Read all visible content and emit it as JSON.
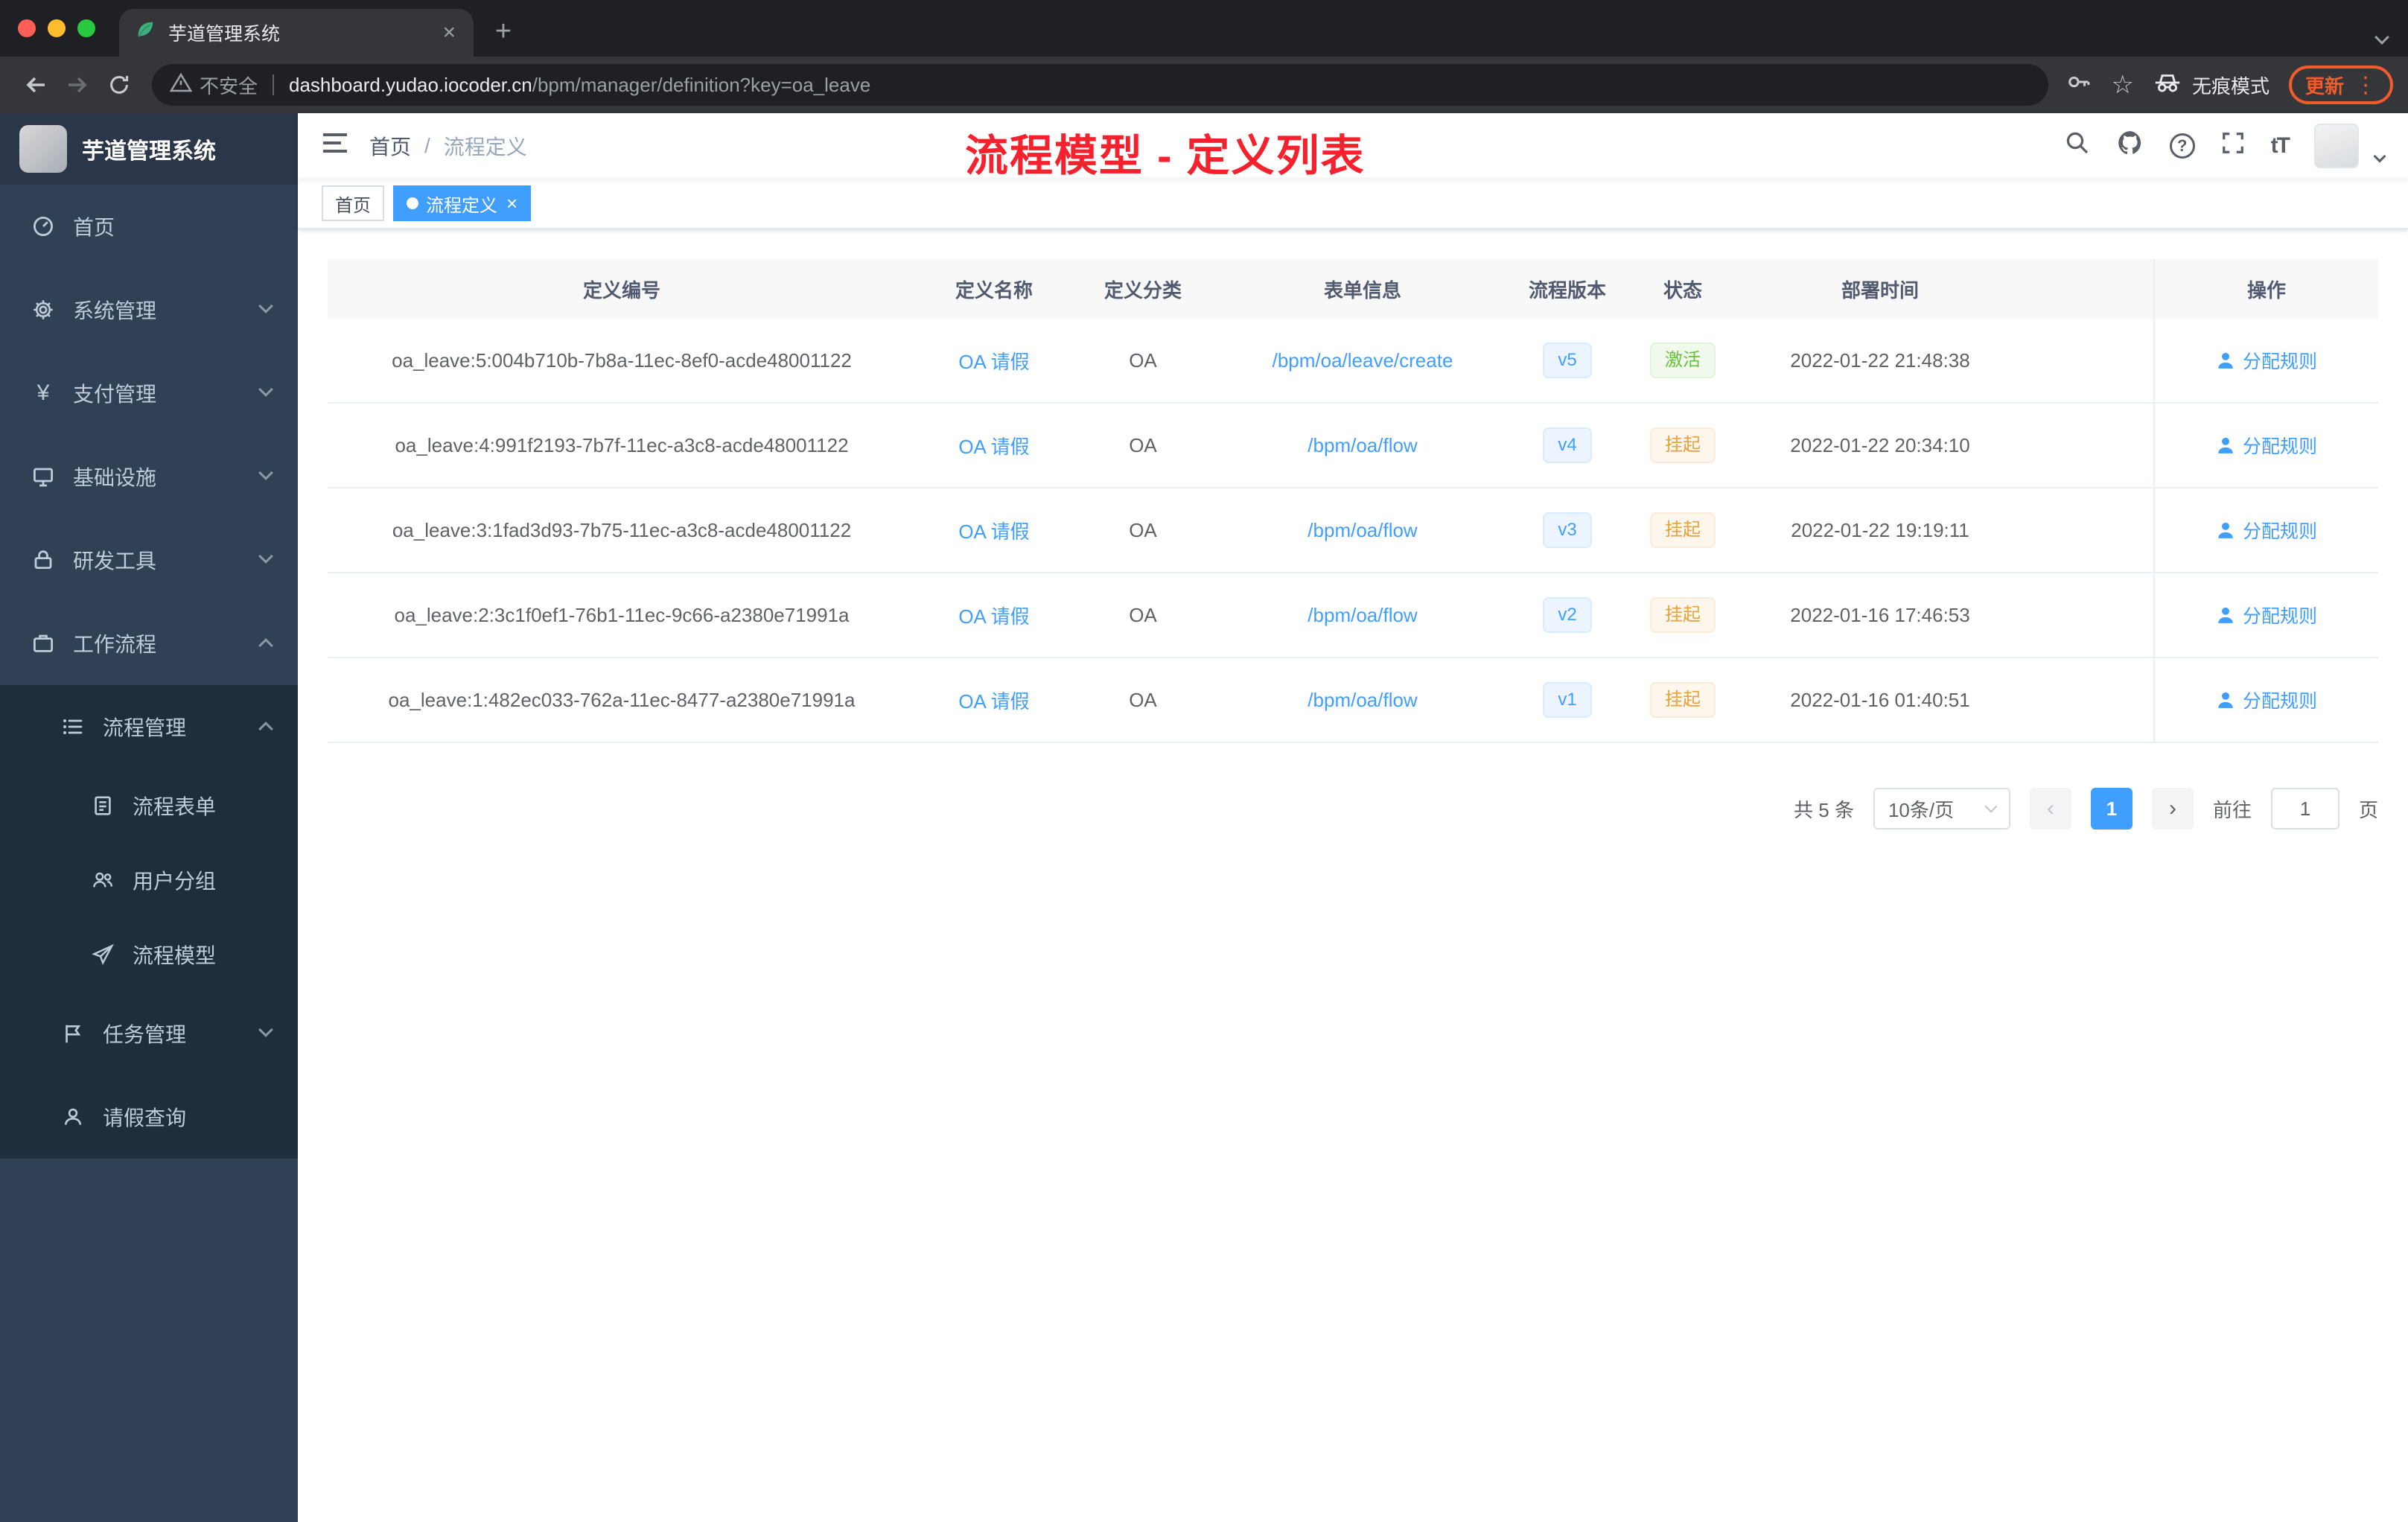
{
  "colors": {
    "accent": "#409eff",
    "success": "#67c23a",
    "warning": "#e6a23c",
    "danger": "#f5222d",
    "update": "#f25b2a"
  },
  "icons": {
    "close_glyph": "×",
    "plus_glyph": "+",
    "star_glyph": "☆",
    "kebab_glyph": "⋮",
    "question_glyph": "?",
    "yen_glyph": "¥",
    "font_size_glyph": "tT",
    "prev_glyph": "‹",
    "next_glyph": "›"
  },
  "browser": {
    "tab_title": "芋道管理系统",
    "security_text": "不安全",
    "url_domain": "dashboard.yudao.iocoder.cn",
    "url_path": "/bpm/manager/definition?key=oa_leave",
    "incognito_label": "无痕模式",
    "update_label": "更新"
  },
  "sidebar": {
    "logo_title": "芋道管理系统",
    "items": [
      {
        "label": "首页"
      },
      {
        "label": "系统管理"
      },
      {
        "label": "支付管理"
      },
      {
        "label": "基础设施"
      },
      {
        "label": "研发工具"
      },
      {
        "label": "工作流程"
      },
      {
        "label": "流程管理"
      },
      {
        "label": "流程表单"
      },
      {
        "label": "用户分组"
      },
      {
        "label": "流程模型"
      },
      {
        "label": "任务管理"
      },
      {
        "label": "请假查询"
      }
    ]
  },
  "header": {
    "breadcrumb_home": "首页",
    "breadcrumb_sep": "/",
    "breadcrumb_current": "流程定义",
    "annotation": "流程模型 - 定义列表"
  },
  "tags": {
    "home": "首页",
    "active": "流程定义"
  },
  "table": {
    "columns": [
      "定义编号",
      "定义名称",
      "定义分类",
      "表单信息",
      "流程版本",
      "状态",
      "部署时间",
      "操作"
    ],
    "rows": [
      {
        "id": "oa_leave:5:004b710b-7b8a-11ec-8ef0-acde48001122",
        "name": "OA 请假",
        "category": "OA",
        "form": "/bpm/oa/leave/create",
        "version": "v5",
        "status": "激活",
        "status_type": "success",
        "deployed_at": "2022-01-22 21:48:38",
        "action": "分配规则"
      },
      {
        "id": "oa_leave:4:991f2193-7b7f-11ec-a3c8-acde48001122",
        "name": "OA 请假",
        "category": "OA",
        "form": "/bpm/oa/flow",
        "version": "v4",
        "status": "挂起",
        "status_type": "warning",
        "deployed_at": "2022-01-22 20:34:10",
        "action": "分配规则"
      },
      {
        "id": "oa_leave:3:1fad3d93-7b75-11ec-a3c8-acde48001122",
        "name": "OA 请假",
        "category": "OA",
        "form": "/bpm/oa/flow",
        "version": "v3",
        "status": "挂起",
        "status_type": "warning",
        "deployed_at": "2022-01-22 19:19:11",
        "action": "分配规则"
      },
      {
        "id": "oa_leave:2:3c1f0ef1-76b1-11ec-9c66-a2380e71991a",
        "name": "OA 请假",
        "category": "OA",
        "form": "/bpm/oa/flow",
        "version": "v2",
        "status": "挂起",
        "status_type": "warning",
        "deployed_at": "2022-01-16 17:46:53",
        "action": "分配规则"
      },
      {
        "id": "oa_leave:1:482ec033-762a-11ec-8477-a2380e71991a",
        "name": "OA 请假",
        "category": "OA",
        "form": "/bpm/oa/flow",
        "version": "v1",
        "status": "挂起",
        "status_type": "warning",
        "deployed_at": "2022-01-16 01:40:51",
        "action": "分配规则"
      }
    ]
  },
  "pagination": {
    "total": "共 5 条",
    "page_size": "10条/页",
    "current": "1",
    "goto": "前往",
    "goto_value": "1",
    "unit": "页"
  }
}
